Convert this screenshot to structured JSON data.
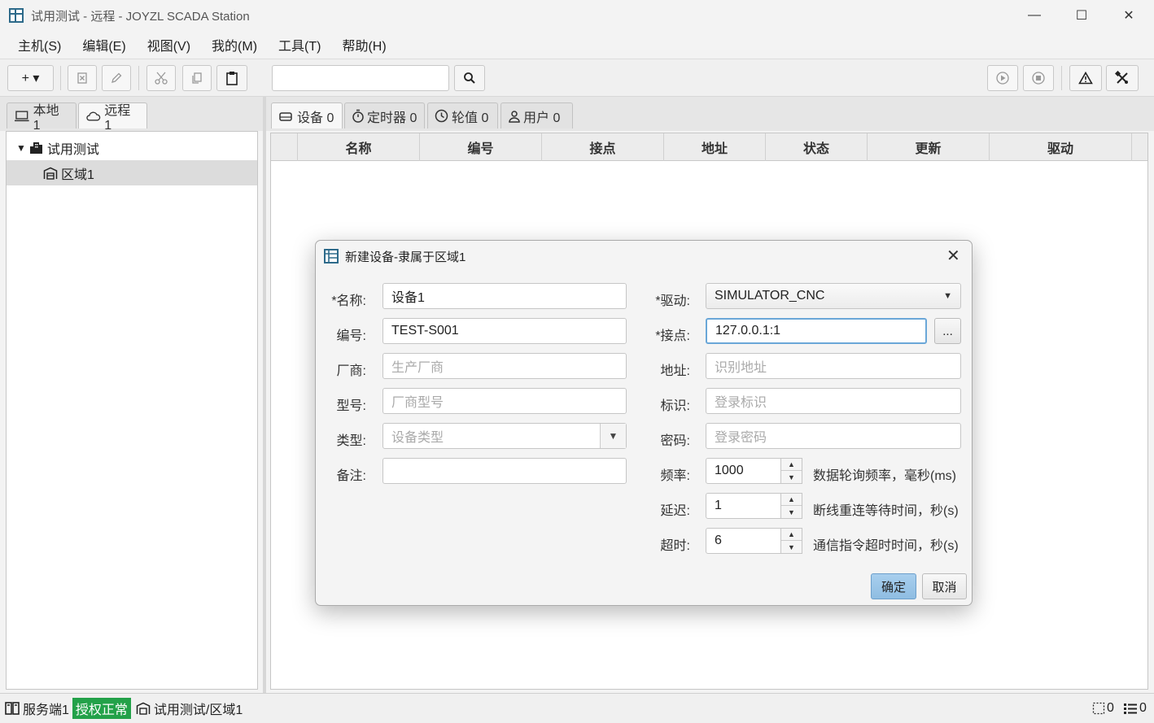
{
  "window": {
    "title": "试用测试 - 远程 - JOYZL SCADA Station",
    "minimize": "—",
    "maximize": "☐",
    "close": "✕"
  },
  "menu": [
    "主机(S)",
    "编辑(E)",
    "视图(V)",
    "我的(M)",
    "工具(T)",
    "帮助(H)"
  ],
  "toolbar": {
    "add_label": "+ ▾",
    "search_value": ""
  },
  "left_tabs": [
    {
      "label": "本地 1"
    },
    {
      "label": "远程 1"
    }
  ],
  "tree": {
    "root": "试用测试",
    "child": "区域1"
  },
  "right_tabs": [
    {
      "label": "设备 0"
    },
    {
      "label": "定时器 0"
    },
    {
      "label": "轮值 0"
    },
    {
      "label": "用户 0"
    }
  ],
  "table": {
    "columns": [
      "名称",
      "编号",
      "接点",
      "地址",
      "状态",
      "更新",
      "驱动"
    ]
  },
  "dialog": {
    "title": "新建设备-隶属于区域1",
    "name_label": "*名称:",
    "name_value": "设备1",
    "code_label": "编号:",
    "code_value": "TEST-S001",
    "vendor_label": "厂商:",
    "vendor_placeholder": "生产厂商",
    "model_label": "型号:",
    "model_placeholder": "厂商型号",
    "type_label": "类型:",
    "type_placeholder": "设备类型",
    "note_label": "备注:",
    "note_value": "",
    "driver_label": "*驱动:",
    "driver_value": "SIMULATOR_CNC",
    "endpoint_label": "*接点:",
    "endpoint_value": "127.0.0.1:1",
    "browse_label": "...",
    "address_label": "地址:",
    "address_placeholder": "识别地址",
    "ident_label": "标识:",
    "ident_placeholder": "登录标识",
    "password_label": "密码:",
    "password_placeholder": "登录密码",
    "freq_label": "频率:",
    "freq_value": "1000",
    "freq_hint": "数据轮询频率，毫秒(ms)",
    "delay_label": "延迟:",
    "delay_value": "1",
    "delay_hint": "断线重连等待时间，秒(s)",
    "timeout_label": "超时:",
    "timeout_value": "6",
    "timeout_hint": "通信指令超时时间，秒(s)",
    "ok_label": "确定",
    "cancel_label": "取消"
  },
  "status": {
    "server": "服务端1",
    "license": "授权正常",
    "path": "试用测试/区域1",
    "sel_count": "0",
    "list_count": "0"
  },
  "colors": {
    "license_badge": "#23a149",
    "primary_button": "#9ac5e8",
    "focus_border": "#6aa7d8"
  }
}
